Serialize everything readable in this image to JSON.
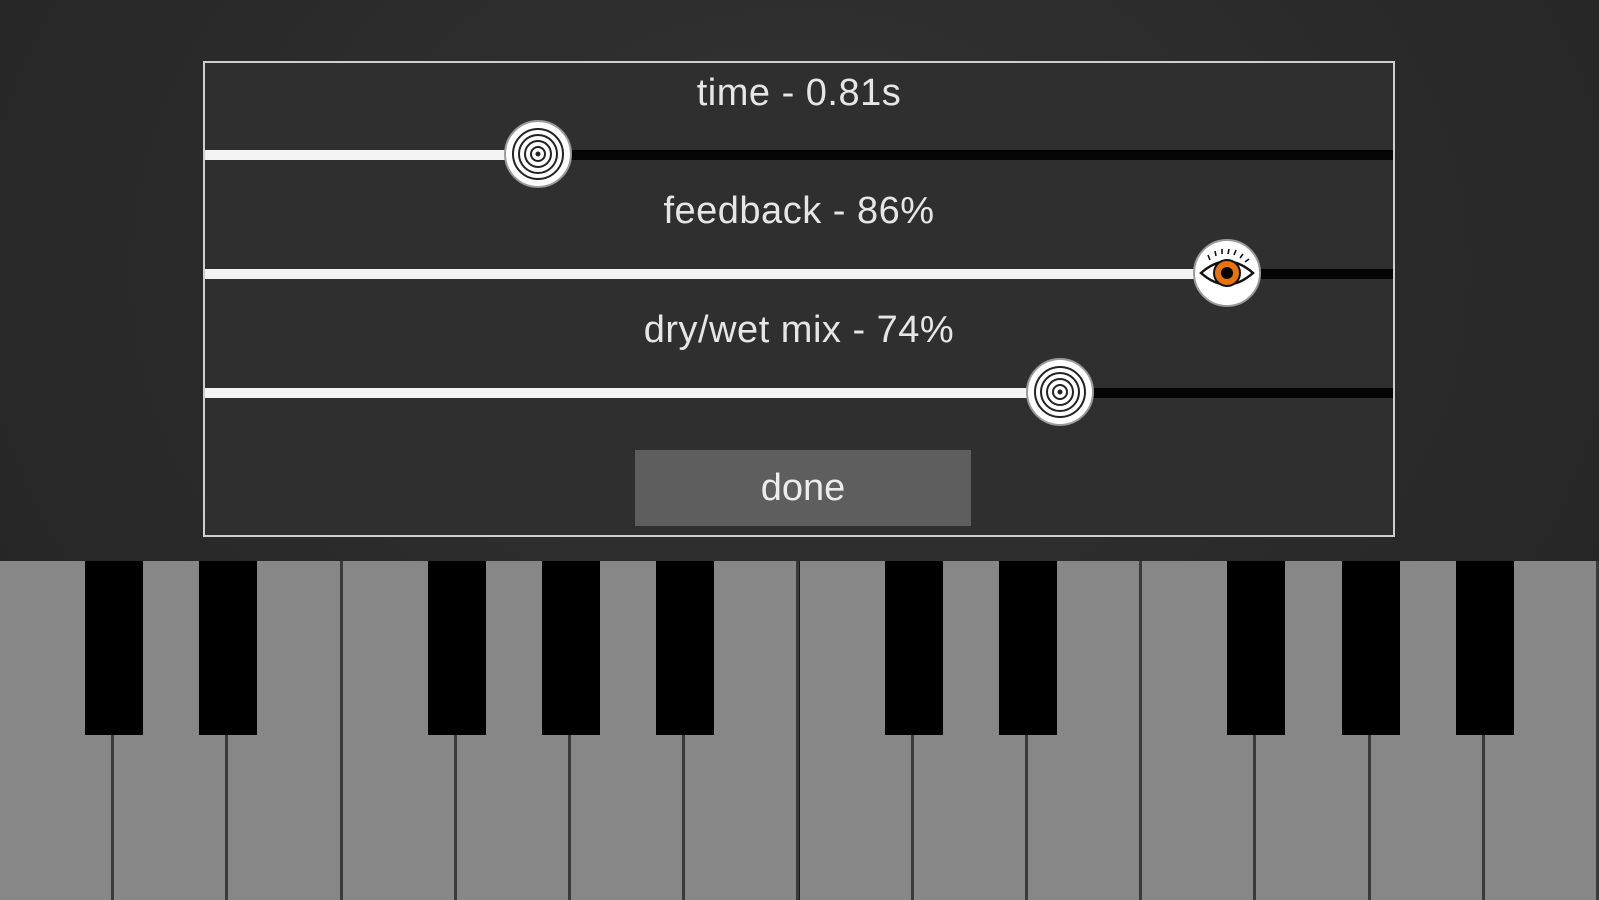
{
  "dialog": {
    "sliders": [
      {
        "id": "time",
        "label": "time - 0.81s",
        "fraction": 0.28,
        "knob_icon": "spiral-icon"
      },
      {
        "id": "feedback",
        "label": "feedback - 86%",
        "fraction": 0.86,
        "knob_icon": "eye-icon"
      },
      {
        "id": "mix",
        "label": "dry/wet mix - 74%",
        "fraction": 0.72,
        "knob_icon": "spiral-icon"
      }
    ],
    "done_label": "done"
  },
  "keyboard": {
    "white_keys": 14,
    "black_key_pattern": [
      "C#",
      "D#",
      "F#",
      "G#",
      "A#",
      "C#",
      "D#",
      "F#",
      "G#",
      "A#"
    ]
  },
  "colors": {
    "track_fill": "#f4f4f4",
    "track_empty": "#050505",
    "eye_iris": "#e8730c",
    "key_white": "#878787",
    "key_black": "#000000"
  }
}
